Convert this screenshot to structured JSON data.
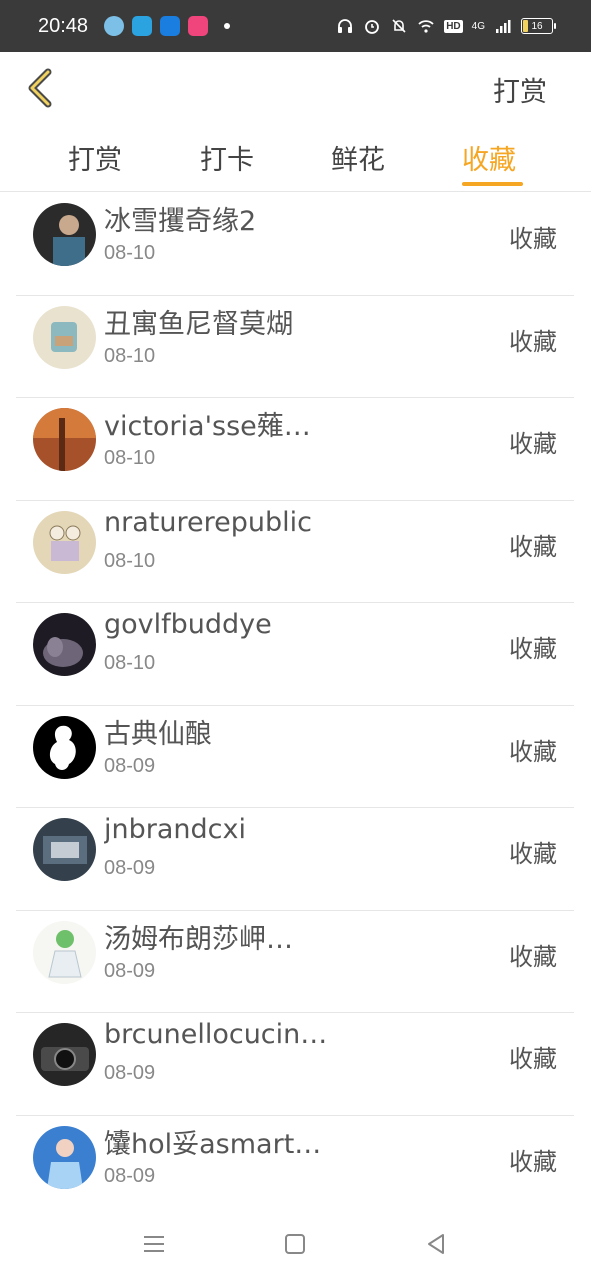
{
  "status_bar": {
    "time": "20:48",
    "network": "4G",
    "hd": "HD",
    "battery": "16",
    "battery_color": "#f2d25e"
  },
  "header": {
    "back_icon": "chevron-left-icon",
    "title": "打赏"
  },
  "tabs": [
    {
      "label": "打赏",
      "active": false
    },
    {
      "label": "打卡",
      "active": false
    },
    {
      "label": "鲜花",
      "active": false
    },
    {
      "label": "收藏",
      "active": true
    }
  ],
  "accent_color": "#f5a623",
  "list": [
    {
      "name": "冰雪攫奇缘2",
      "date": "08-10",
      "action": "收藏"
    },
    {
      "name": "丑寓鱼尼督莫煳",
      "date": "08-10",
      "action": "收藏"
    },
    {
      "name": "victoria'sse薙…",
      "date": "08-10",
      "action": "收藏"
    },
    {
      "name": "nraturerepublic",
      "date": "08-10",
      "action": "收藏"
    },
    {
      "name": "govlfbuddye",
      "date": "08-10",
      "action": "收藏"
    },
    {
      "name": "古典仙酿",
      "date": "08-09",
      "action": "收藏"
    },
    {
      "name": "jnbrandcxi",
      "date": "08-09",
      "action": "收藏"
    },
    {
      "name": "汤姆布朗莎岬…",
      "date": "08-09",
      "action": "收藏"
    },
    {
      "name": "brcunellocucin…",
      "date": "08-09",
      "action": "收藏"
    },
    {
      "name": "馕hol妥asmart…",
      "date": "08-09",
      "action": "收藏"
    }
  ],
  "nav_bar": {
    "menu_icon": "menu-icon",
    "home_icon": "home-square-icon",
    "back_icon": "back-triangle-icon"
  }
}
